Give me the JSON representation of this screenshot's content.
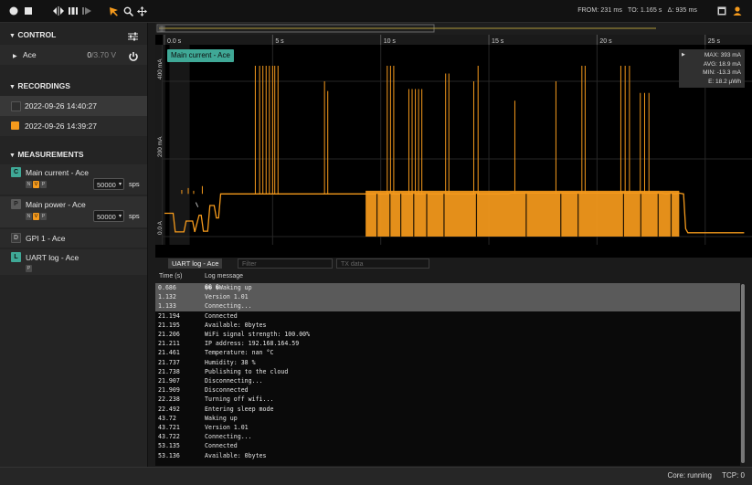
{
  "toolbar": {
    "from_label": "FROM: 231 ms",
    "to_label": "TO: 1.165 s",
    "delta_label": "Δ: 935 ms"
  },
  "control": {
    "title": "CONTROL",
    "device": "Ace",
    "voltage_set": "0",
    "voltage_max": "/3.70 V"
  },
  "recordings": {
    "title": "RECORDINGS",
    "items": [
      {
        "label": "2022-09-26 14:40:27",
        "color": "#3a3a3a"
      },
      {
        "label": "2022-09-26 14:39:27",
        "color": "#f59a1c"
      }
    ]
  },
  "measurements": {
    "title": "MEASUREMENTS",
    "items": [
      {
        "chip": "C",
        "chip_color": "#3fa896",
        "label": "Main current - Ace",
        "sps": "50000",
        "unit": "sps",
        "flags": [
          "N",
          "V",
          "P"
        ]
      },
      {
        "chip": "P",
        "chip_color": "#5a5a5a",
        "label": "Main power - Ace",
        "sps": "50000",
        "unit": "sps",
        "flags": [
          "N",
          "V",
          "P"
        ]
      },
      {
        "chip": "D",
        "chip_color": "#3a3a3a",
        "label": "GPI 1 - Ace"
      },
      {
        "chip": "L",
        "chip_color": "#3fa896",
        "label": "UART log - Ace",
        "flags": [
          "P"
        ]
      }
    ]
  },
  "plot": {
    "series_label": "Main current - Ace",
    "x_ticks": [
      "0.0 s",
      "5 s",
      "10 s",
      "15 s",
      "20 s",
      "25 s"
    ],
    "y_ticks": [
      "400 mA",
      "200 mA",
      "0.0 A"
    ],
    "stats": {
      "max": "MAX: 393 mA",
      "avg": "AVG: 18.9 mA",
      "min": "MIN: -13.3 mA",
      "energy": "E: 18.2 µWh"
    },
    "color": "#f59a1c"
  },
  "log": {
    "tab_label": "UART log - Ace",
    "filter_placeholder": "Filter",
    "tx_placeholder": "TX data",
    "col_time": "Time (s)",
    "col_msg": "Log message",
    "rows": [
      {
        "t": "0.686",
        "m": "�� �Waking up"
      },
      {
        "t": "1.132",
        "m": "Version 1.01"
      },
      {
        "t": "1.133",
        "m": "Connecting..."
      },
      {
        "t": "21.194",
        "m": "Connected"
      },
      {
        "t": "21.195",
        "m": "Available: 0bytes"
      },
      {
        "t": "21.206",
        "m": "WiFi signal strength: 100.00%"
      },
      {
        "t": "21.211",
        "m": "IP address: 192.168.164.59"
      },
      {
        "t": "21.461",
        "m": "Temperature: nan °C"
      },
      {
        "t": "21.737",
        "m": "Humidity: 38 %"
      },
      {
        "t": "21.738",
        "m": "Publishing to the cloud"
      },
      {
        "t": "21.907",
        "m": "Disconnecting..."
      },
      {
        "t": "21.909",
        "m": "Disconnected"
      },
      {
        "t": "22.238",
        "m": "Turning off wifi..."
      },
      {
        "t": "22.492",
        "m": "Entering sleep mode"
      },
      {
        "t": "43.72",
        "m": "Waking up"
      },
      {
        "t": "43.721",
        "m": "Version 1.01"
      },
      {
        "t": "43.722",
        "m": "Connecting..."
      },
      {
        "t": "53.135",
        "m": "Connected"
      },
      {
        "t": "53.136",
        "m": "Available: 0bytes"
      }
    ],
    "highlighted_rows": 3
  },
  "status": {
    "core": "Core: running",
    "tcp": "TCP: 0"
  }
}
